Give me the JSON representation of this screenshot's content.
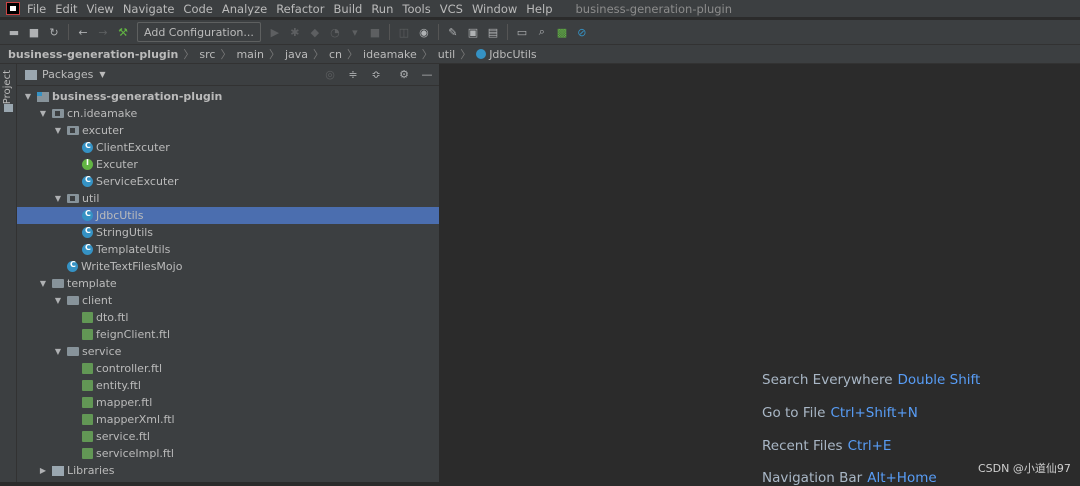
{
  "menubar": {
    "items": [
      "File",
      "Edit",
      "View",
      "Navigate",
      "Code",
      "Analyze",
      "Refactor",
      "Build",
      "Run",
      "Tools",
      "VCS",
      "Window",
      "Help"
    ],
    "window_title": "business-generation-plugin"
  },
  "toolbar": {
    "add_configuration_label": "Add Configuration..."
  },
  "breadcrumb": {
    "items": [
      "business-generation-plugin",
      "src",
      "main",
      "java",
      "cn",
      "ideamake",
      "util",
      "JdbcUtils"
    ]
  },
  "leftstrip": {
    "label": "Project"
  },
  "panel": {
    "title": "Packages",
    "tree": [
      {
        "label": "business-generation-plugin",
        "depth": 0,
        "icon": "module-icon",
        "expanded": true,
        "bold": true
      },
      {
        "label": "cn.ideamake",
        "depth": 1,
        "icon": "package-icon",
        "expanded": true
      },
      {
        "label": "excuter",
        "depth": 2,
        "icon": "package-icon",
        "expanded": true
      },
      {
        "label": "ClientExcuter",
        "depth": 3,
        "icon": "class-icon"
      },
      {
        "label": "Excuter",
        "depth": 3,
        "icon": "interface-icon"
      },
      {
        "label": "ServiceExcuter",
        "depth": 3,
        "icon": "class-icon"
      },
      {
        "label": "util",
        "depth": 2,
        "icon": "package-icon",
        "expanded": true
      },
      {
        "label": "JdbcUtils",
        "depth": 3,
        "icon": "class-icon",
        "selected": true
      },
      {
        "label": "StringUtils",
        "depth": 3,
        "icon": "class-icon"
      },
      {
        "label": "TemplateUtils",
        "depth": 3,
        "icon": "class-icon"
      },
      {
        "label": "WriteTextFilesMojo",
        "depth": 2,
        "icon": "class-icon"
      },
      {
        "label": "template",
        "depth": 1,
        "icon": "folder-icon",
        "expanded": true
      },
      {
        "label": "client",
        "depth": 2,
        "icon": "folder-icon",
        "expanded": true
      },
      {
        "label": "dto.ftl",
        "depth": 3,
        "icon": "ftl-file-icon"
      },
      {
        "label": "feignClient.ftl",
        "depth": 3,
        "icon": "ftl-file-icon"
      },
      {
        "label": "service",
        "depth": 2,
        "icon": "folder-icon",
        "expanded": true
      },
      {
        "label": "controller.ftl",
        "depth": 3,
        "icon": "ftl-file-icon"
      },
      {
        "label": "entity.ftl",
        "depth": 3,
        "icon": "ftl-file-icon"
      },
      {
        "label": "mapper.ftl",
        "depth": 3,
        "icon": "ftl-file-icon"
      },
      {
        "label": "mapperXml.ftl",
        "depth": 3,
        "icon": "ftl-file-icon"
      },
      {
        "label": "service.ftl",
        "depth": 3,
        "icon": "ftl-file-icon"
      },
      {
        "label": "serviceImpl.ftl",
        "depth": 3,
        "icon": "ftl-file-icon"
      },
      {
        "label": "Libraries",
        "depth": 1,
        "icon": "libraries-icon",
        "expanded": false
      }
    ]
  },
  "editor": {
    "hints": [
      {
        "text": "Search Everywhere",
        "shortcut": "Double Shift"
      },
      {
        "text": "Go to File",
        "shortcut": "Ctrl+Shift+N"
      },
      {
        "text": "Recent Files",
        "shortcut": "Ctrl+E"
      },
      {
        "text": "Navigation Bar",
        "shortcut": "Alt+Home"
      }
    ]
  },
  "watermark": "CSDN @小道仙97",
  "colors": {
    "selection": "#4b6eaf",
    "link": "#589df6",
    "class": "#3592c4",
    "interface": "#62b543",
    "ftl": "#629755"
  }
}
